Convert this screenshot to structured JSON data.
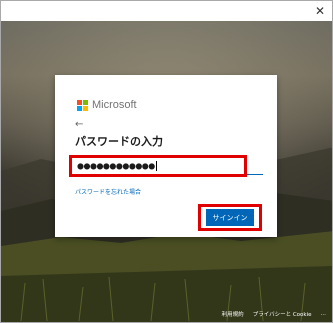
{
  "window": {
    "close_glyph": "✕"
  },
  "brand": {
    "name": "Microsoft",
    "logo_colors": [
      "#f25022",
      "#7fba00",
      "#00a4ef",
      "#ffb900"
    ]
  },
  "dialog": {
    "back_glyph": "←",
    "heading": "パスワードの入力",
    "password_value": "●●●●●●●●●●●●",
    "forgot_link": "パスワードを忘れた場合",
    "signin_label": "サインイン",
    "accent_color": "#0067b8",
    "highlight_color": "#e00000"
  },
  "footer": {
    "terms": "利用規約",
    "privacy": "プライバシーと Cookie",
    "more": "…"
  }
}
